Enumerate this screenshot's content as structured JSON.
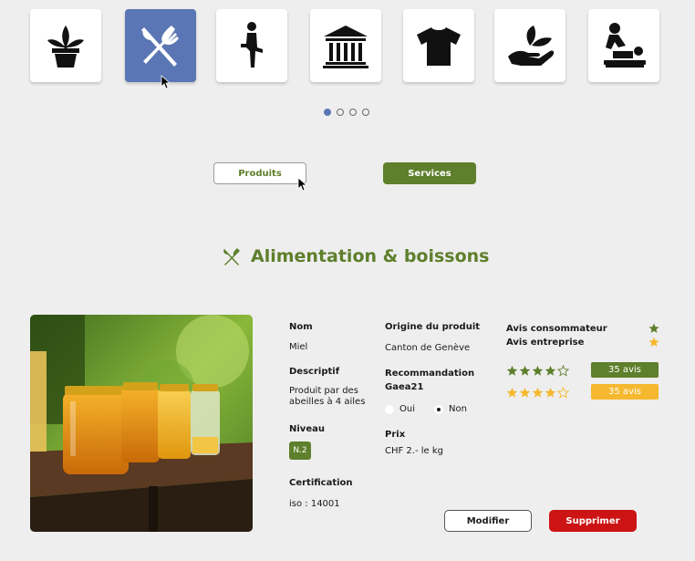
{
  "categories": [
    {
      "icon": "plant-pot-icon",
      "active": false
    },
    {
      "icon": "fork-knife-icon",
      "active": true
    },
    {
      "icon": "yoga-person-icon",
      "active": false
    },
    {
      "icon": "institution-building-icon",
      "active": false
    },
    {
      "icon": "tshirt-icon",
      "active": false
    },
    {
      "icon": "hand-with-leaves-icon",
      "active": false
    },
    {
      "icon": "massage-icon",
      "active": false
    }
  ],
  "carousel": {
    "pages": 4,
    "active_page": 1
  },
  "toggle": {
    "produits_label": "Produits",
    "services_label": "Services"
  },
  "section": {
    "icon": "fork-knife-icon",
    "title": "Alimentation & boissons"
  },
  "product": {
    "image_alt": "honey-jars-photo",
    "nom_label": "Nom",
    "nom_value": "Miel",
    "descriptif_label": "Descriptif",
    "descriptif_value_line1": "Produit par des",
    "descriptif_value_line2": "abeilles à 4 ailes",
    "niveau_label": "Niveau",
    "niveau_value": "N.2",
    "certification_label": "Certification",
    "certification_value": "iso : 14001",
    "origine_label": "Origine du produit",
    "origine_value": "Canton de Genève",
    "recommandation_label_line1": "Recommandation",
    "recommandation_label_line2": "Gaea21",
    "oui_label": "Oui",
    "non_label": "Non",
    "recommandation_selected": "Non",
    "prix_label": "Prix",
    "prix_value": "CHF 2.- le kg"
  },
  "ratings": {
    "consommateur_label": "Avis consommateur",
    "entreprise_label": "Avis entreprise",
    "consommateur_stars": 4,
    "entreprise_stars": 4,
    "max_stars": 5,
    "consommateur_avis": "35 avis",
    "entreprise_avis": "35 avis",
    "green": "#5e7f2b",
    "yellow": "#f5b82e"
  },
  "actions": {
    "modifier_label": "Modifier",
    "supprimer_label": "Supprimer"
  },
  "colors": {
    "accent_blue": "#5b76b4",
    "accent_green": "#5e7f2b",
    "danger_red": "#cc1414"
  }
}
